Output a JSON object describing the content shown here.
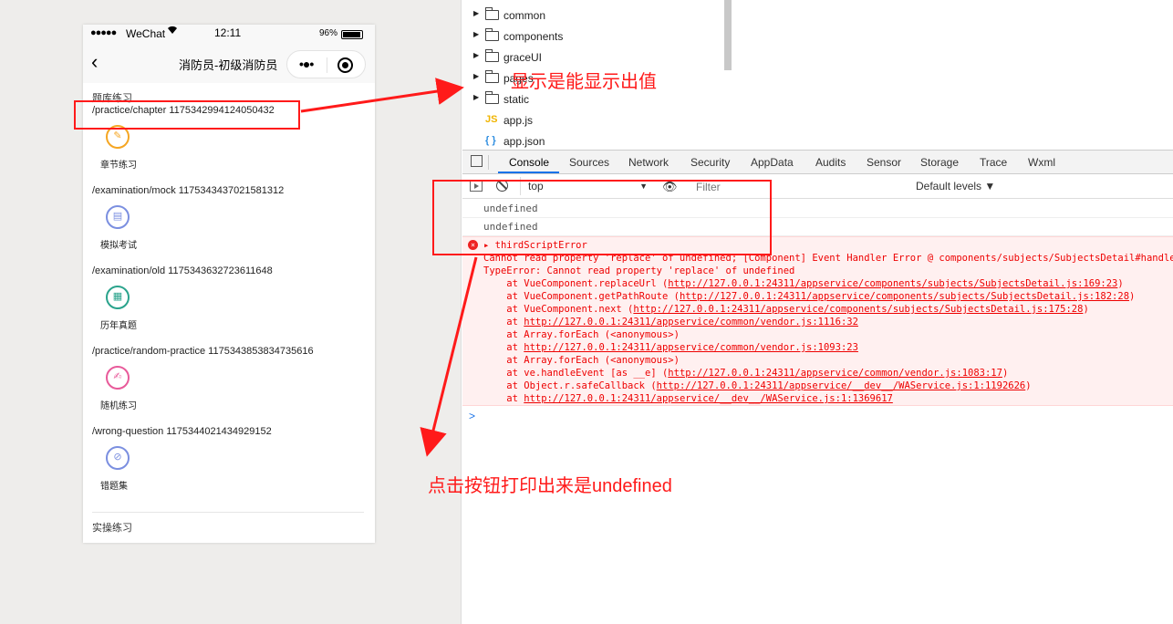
{
  "status_bar": {
    "signal": "●●●●●",
    "carrier": "WeChat",
    "time": "12:11",
    "battery": "96%"
  },
  "nav": {
    "back_icon": "‹",
    "title": "消防员-初级消防员",
    "more_icon": "•●•"
  },
  "practice": {
    "section_title": "题库练习",
    "items": [
      {
        "path": "/practice/chapter 1175342994124050432",
        "label": "章节练习",
        "icon": "✎",
        "color": "#f5a623"
      },
      {
        "path": "/examination/mock 1175343437021581312",
        "label": "模拟考试",
        "icon": "▤",
        "color": "#7b8fe0"
      },
      {
        "path": "/examination/old 1175343632723611648",
        "label": "历年真题",
        "icon": "▦",
        "color": "#2aa38c"
      },
      {
        "path": "/practice/random-practice 1175343853834735616",
        "label": "随机练习",
        "icon": "✍",
        "color": "#e85a9a"
      },
      {
        "path": "/wrong-question 1175344021434929152",
        "label": "错题集",
        "icon": "⊘",
        "color": "#7b8fe0"
      }
    ],
    "second_section_title": "实操练习"
  },
  "file_tree": [
    {
      "name": "common",
      "type": "folder"
    },
    {
      "name": "components",
      "type": "folder"
    },
    {
      "name": "graceUI",
      "type": "folder"
    },
    {
      "name": "pages",
      "type": "folder"
    },
    {
      "name": "static",
      "type": "folder"
    },
    {
      "name": "app.js",
      "type": "js",
      "icon": "JS"
    },
    {
      "name": "app.json",
      "type": "json",
      "icon": "{ }"
    }
  ],
  "devtools": {
    "tabs": [
      "Console",
      "Sources",
      "Network",
      "Security",
      "AppData",
      "Audits",
      "Sensor",
      "Storage",
      "Trace",
      "Wxml"
    ],
    "active_tab": "Console",
    "context": "top",
    "filter_placeholder": "Filter",
    "levels": "Default levels ▼"
  },
  "console": {
    "logs": [
      "undefined",
      "undefined"
    ],
    "error": {
      "title": "▸ thirdScriptError",
      "lines": [
        "Cannot read property 'replace' of undefined; [Component] Event Handler Error @ components/subjects/SubjectsDetail#handleTap",
        "TypeError: Cannot read property 'replace' of undefined",
        "    at VueComponent.replaceUrl (http://127.0.0.1:24311/appservice/components/subjects/SubjectsDetail.js:169:23)",
        "    at VueComponent.getPathRoute (http://127.0.0.1:24311/appservice/components/subjects/SubjectsDetail.js:182:28)",
        "    at VueComponent.next (http://127.0.0.1:24311/appservice/components/subjects/SubjectsDetail.js:175:28)",
        "    at http://127.0.0.1:24311/appservice/common/vendor.js:1116:32",
        "    at Array.forEach (<anonymous>)",
        "    at http://127.0.0.1:24311/appservice/common/vendor.js:1093:23",
        "    at Array.forEach (<anonymous>)",
        "    at ve.handleEvent [as __e] (http://127.0.0.1:24311/appservice/common/vendor.js:1083:17)",
        "    at Object.r.safeCallback (http://127.0.0.1:24311/appservice/__dev__/WAService.js:1:1192626)",
        "    at http://127.0.0.1:24311/appservice/__dev__/WAService.js:1:1369617"
      ]
    },
    "prompt": ">"
  },
  "annotations": {
    "top_note": "显示是能显示出值",
    "bottom_note": "点击按钮打印出来是undefined"
  }
}
